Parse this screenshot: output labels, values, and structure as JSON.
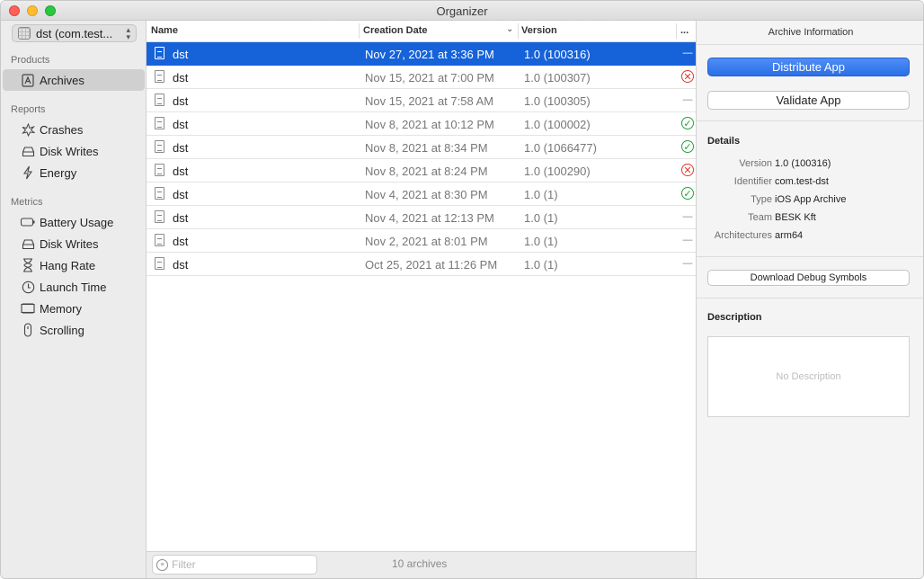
{
  "window": {
    "title": "Organizer"
  },
  "sidebar": {
    "app_picker": "dst (com.test...",
    "products_header": "Products",
    "products": [
      {
        "label": "Archives",
        "icon": "archive-icon"
      }
    ],
    "reports_header": "Reports",
    "reports": [
      {
        "label": "Crashes",
        "icon": "crash-icon"
      },
      {
        "label": "Disk Writes",
        "icon": "disk-icon"
      },
      {
        "label": "Energy",
        "icon": "energy-icon"
      }
    ],
    "metrics_header": "Metrics",
    "metrics": [
      {
        "label": "Battery Usage",
        "icon": "battery-icon"
      },
      {
        "label": "Disk Writes",
        "icon": "disk-icon"
      },
      {
        "label": "Hang Rate",
        "icon": "hourglass-icon"
      },
      {
        "label": "Launch Time",
        "icon": "clock-icon"
      },
      {
        "label": "Memory",
        "icon": "memory-icon"
      },
      {
        "label": "Scrolling",
        "icon": "scroll-icon"
      }
    ]
  },
  "list": {
    "columns": {
      "name": "Name",
      "date": "Creation Date",
      "version": "Version",
      "more": "..."
    },
    "rows": [
      {
        "name": "dst",
        "date": "Nov 27, 2021 at 3:36 PM",
        "version": "1.0 (100316)",
        "status": "none"
      },
      {
        "name": "dst",
        "date": "Nov 15, 2021 at 7:00 PM",
        "version": "1.0 (100307)",
        "status": "error"
      },
      {
        "name": "dst",
        "date": "Nov 15, 2021 at 7:58 AM",
        "version": "1.0 (100305)",
        "status": "none"
      },
      {
        "name": "dst",
        "date": "Nov 8, 2021 at 10:12 PM",
        "version": "1.0 (100002)",
        "status": "ok"
      },
      {
        "name": "dst",
        "date": "Nov 8, 2021 at 8:34 PM",
        "version": "1.0 (1066477)",
        "status": "ok"
      },
      {
        "name": "dst",
        "date": "Nov 8, 2021 at 8:24 PM",
        "version": "1.0 (100290)",
        "status": "error"
      },
      {
        "name": "dst",
        "date": "Nov 4, 2021 at 8:30 PM",
        "version": "1.0 (1)",
        "status": "ok"
      },
      {
        "name": "dst",
        "date": "Nov 4, 2021 at 12:13 PM",
        "version": "1.0 (1)",
        "status": "none"
      },
      {
        "name": "dst",
        "date": "Nov 2, 2021 at 8:01 PM",
        "version": "1.0 (1)",
        "status": "none"
      },
      {
        "name": "dst",
        "date": "Oct 25, 2021 at 11:26 PM",
        "version": "1.0 (1)",
        "status": "none"
      }
    ],
    "selected_index": 0
  },
  "footer": {
    "filter_placeholder": "Filter",
    "archive_count": "10 archives"
  },
  "inspector": {
    "title": "Archive Information",
    "distribute_button": "Distribute App",
    "validate_button": "Validate App",
    "details_header": "Details",
    "details": [
      {
        "key": "Version",
        "value": "1.0 (100316)"
      },
      {
        "key": "Identifier",
        "value": "com.test-dst"
      },
      {
        "key": "Type",
        "value": "iOS App Archive"
      },
      {
        "key": "Team",
        "value": "BESK Kft"
      },
      {
        "key": "Architectures",
        "value": "arm64"
      }
    ],
    "debug_symbols_button": "Download Debug Symbols",
    "description_header": "Description",
    "description_placeholder": "No Description"
  },
  "colors": {
    "selection": "#1662d9",
    "primary_button": "#2b6fe6",
    "ok": "#27a13b",
    "error": "#e0392e"
  }
}
